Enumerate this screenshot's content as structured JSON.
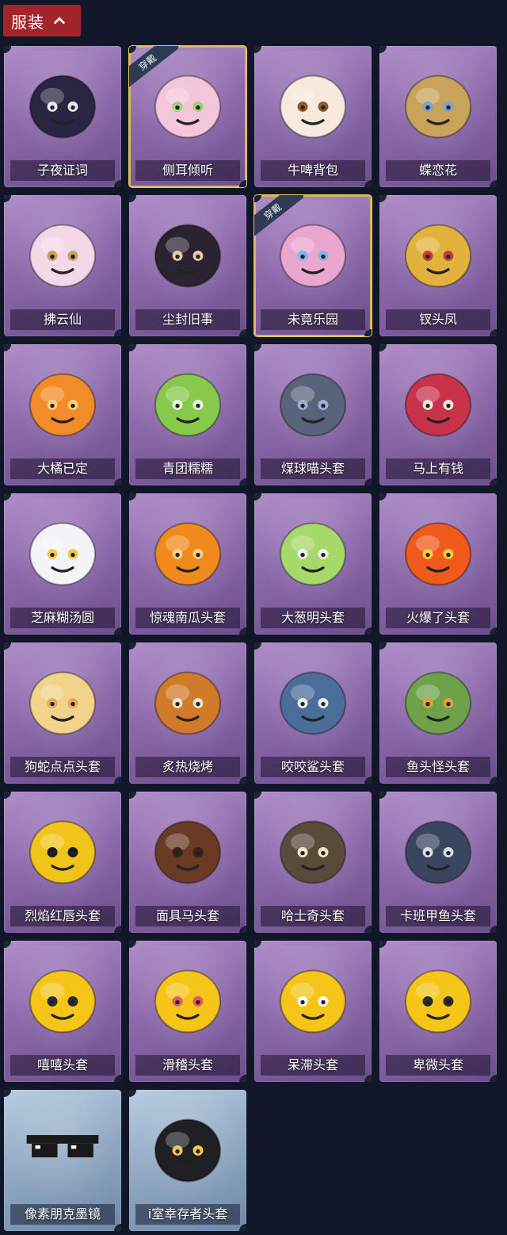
{
  "header": {
    "title": "服装",
    "collapse_icon": "chevron-up-icon"
  },
  "worn_badge": "穿戴",
  "items": [
    {
      "name": "子夜证词",
      "icon": "dark-crow-doll-icon",
      "worn": false,
      "rarity": "purple"
    },
    {
      "name": "侧耳倾听",
      "icon": "lotus-wreath-icon",
      "worn": true,
      "rarity": "purple"
    },
    {
      "name": "牛啤背包",
      "icon": "cow-barrel-backpack-icon",
      "worn": false,
      "rarity": "purple"
    },
    {
      "name": "蝶恋花",
      "icon": "butterfly-bell-icon",
      "worn": false,
      "rarity": "purple"
    },
    {
      "name": "拂云仙",
      "icon": "fairy-pendant-icon",
      "worn": false,
      "rarity": "purple"
    },
    {
      "name": "尘封旧事",
      "icon": "chibi-figure-pendant-icon",
      "worn": false,
      "rarity": "purple"
    },
    {
      "name": "未竟乐园",
      "icon": "pink-hair-doll-icon",
      "worn": true,
      "rarity": "purple"
    },
    {
      "name": "钗头凤",
      "icon": "phoenix-crown-doll-icon",
      "worn": false,
      "rarity": "purple"
    },
    {
      "name": "大橘已定",
      "icon": "orange-slice-icon",
      "worn": false,
      "rarity": "purple"
    },
    {
      "name": "青团糯糯",
      "icon": "green-dumpling-icon",
      "worn": false,
      "rarity": "purple"
    },
    {
      "name": "煤球喵头套",
      "icon": "grey-cat-head-icon",
      "worn": false,
      "rarity": "purple"
    },
    {
      "name": "马上有钱",
      "icon": "red-horse-head-icon",
      "worn": false,
      "rarity": "purple"
    },
    {
      "name": "芝麻糊汤圆",
      "icon": "white-dumpling-icon",
      "worn": false,
      "rarity": "purple"
    },
    {
      "name": "惊魂南瓜头套",
      "icon": "pumpkin-head-icon",
      "worn": false,
      "rarity": "purple"
    },
    {
      "name": "大葱明头套",
      "icon": "scallion-head-icon",
      "worn": false,
      "rarity": "purple"
    },
    {
      "name": "火爆了头套",
      "icon": "fire-head-icon",
      "worn": false,
      "rarity": "purple"
    },
    {
      "name": "狗蛇点点头套",
      "icon": "snake-head-icon",
      "worn": false,
      "rarity": "purple"
    },
    {
      "name": "炙热烧烤",
      "icon": "bbq-meat-head-icon",
      "worn": false,
      "rarity": "purple"
    },
    {
      "name": "咬咬鲨头套",
      "icon": "shark-head-icon",
      "worn": false,
      "rarity": "purple"
    },
    {
      "name": "鱼头怪头套",
      "icon": "fish-head-icon",
      "worn": false,
      "rarity": "purple"
    },
    {
      "name": "烈焰红唇头套",
      "icon": "yellow-creature-sunglasses-icon",
      "worn": false,
      "rarity": "purple"
    },
    {
      "name": "面具马头套",
      "icon": "horse-mask-icon",
      "worn": false,
      "rarity": "purple"
    },
    {
      "name": "哈士奇头套",
      "icon": "husky-sunglasses-icon",
      "worn": false,
      "rarity": "purple"
    },
    {
      "name": "卡班甲鱼头套",
      "icon": "round-fish-head-icon",
      "worn": false,
      "rarity": "purple"
    },
    {
      "name": "嘻嘻头套",
      "icon": "grin-emoji-head-icon",
      "worn": false,
      "rarity": "purple"
    },
    {
      "name": "滑稽头套",
      "icon": "smirk-emoji-head-icon",
      "worn": false,
      "rarity": "purple"
    },
    {
      "name": "呆滞头套",
      "icon": "stare-emoji-head-icon",
      "worn": false,
      "rarity": "purple"
    },
    {
      "name": "卑微头套",
      "icon": "timid-emoji-head-icon",
      "worn": false,
      "rarity": "purple"
    },
    {
      "name": "像素朋克墨镜",
      "icon": "pixel-sunglasses-icon",
      "worn": false,
      "rarity": "blue"
    },
    {
      "name": "i室幸存者头套",
      "icon": "gas-mask-helmet-icon",
      "worn": false,
      "rarity": "blue"
    }
  ],
  "colors": {
    "background": "#0f1728",
    "header": "#a3242a",
    "purple_card": "#8d69ab",
    "blue_card": "#92aac4",
    "worn_border": "#d9b45a"
  }
}
